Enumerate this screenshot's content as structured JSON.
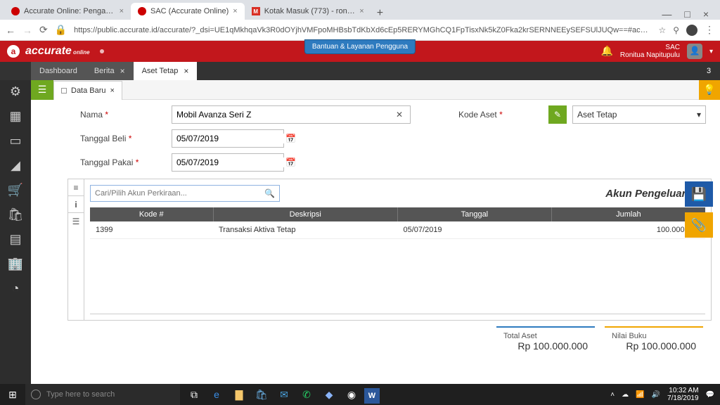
{
  "browser": {
    "tabs": [
      {
        "title": "Accurate Online: Pengaturan Dat"
      },
      {
        "title": "SAC (Accurate Online)"
      },
      {
        "title": "Kotak Masuk (773) - roni.rikson@"
      }
    ],
    "url": "https://public.accurate.id/accurate/?_dsi=UE1qMkhqaVk3R0dOYjhVMFpoMHBsbTdKbXd6cEp5RERYMGhCQ1FpTisxNk5kZ0Fka2krSERNNEEySEFSUlJUQw==#accurate_f…"
  },
  "header": {
    "help": "Bantuan & Layanan Pengguna",
    "company": "SAC",
    "user": "Ronitua Napitupulu"
  },
  "app_tabs": {
    "items": [
      "Dashboard",
      "Berita",
      "Aset Tetap"
    ],
    "notif_count": "3"
  },
  "doc_tab": {
    "label": "Data Baru"
  },
  "form": {
    "nama_label": "Nama",
    "nama_value": "Mobil Avanza Seri Z",
    "tgl_beli_label": "Tanggal Beli",
    "tgl_beli_value": "05/07/2019",
    "tgl_pakai_label": "Tanggal Pakai",
    "tgl_pakai_value": "05/07/2019",
    "kode_label": "Kode Aset",
    "kode_value": "Aset Tetap",
    "search_placeholder": "Cari/Pilih Akun Perkiraan...",
    "section_title": "Akun Pengeluaran"
  },
  "grid": {
    "headers": {
      "kode": "Kode #",
      "deskripsi": "Deskripsi",
      "tanggal": "Tanggal",
      "jumlah": "Jumlah"
    },
    "rows": [
      {
        "kode": "1399",
        "deskripsi": "Transaksi Aktiva Tetap",
        "tanggal": "05/07/2019",
        "jumlah": "100.000.000"
      }
    ]
  },
  "totals": {
    "total_label": "Total Aset",
    "total_value": "Rp 100.000.000",
    "nilai_label": "Nilai Buku",
    "nilai_value": "Rp 100.000.000"
  },
  "taskbar": {
    "search_placeholder": "Type here to search",
    "time": "10:32 AM",
    "date": "7/18/2019"
  }
}
